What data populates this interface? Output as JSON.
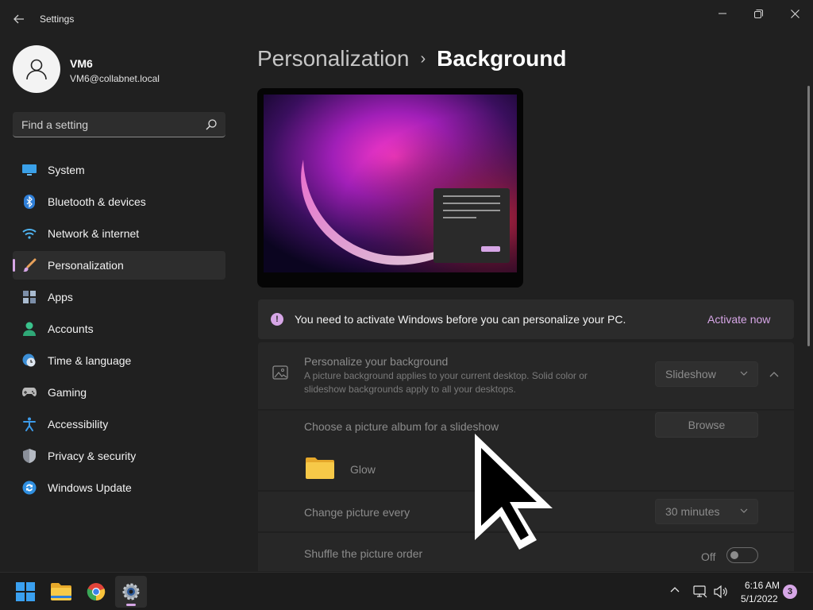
{
  "window": {
    "title": "Settings",
    "back_icon": "arrow-left-icon",
    "minimize_icon": "minimize-icon",
    "restore_icon": "restore-icon",
    "close_icon": "close-icon"
  },
  "profile": {
    "name": "VM6",
    "email": "VM6@collabnet.local",
    "avatar_icon": "person-icon"
  },
  "search": {
    "placeholder": "Find a setting",
    "icon": "search-icon"
  },
  "sidebar": {
    "items": [
      {
        "label": "System",
        "icon": "monitor-icon"
      },
      {
        "label": "Bluetooth & devices",
        "icon": "bluetooth-icon"
      },
      {
        "label": "Network & internet",
        "icon": "wifi-icon"
      },
      {
        "label": "Personalization",
        "icon": "brush-icon",
        "active": true
      },
      {
        "label": "Apps",
        "icon": "apps-icon"
      },
      {
        "label": "Accounts",
        "icon": "account-icon"
      },
      {
        "label": "Time & language",
        "icon": "globe-clock-icon"
      },
      {
        "label": "Gaming",
        "icon": "gamepad-icon"
      },
      {
        "label": "Accessibility",
        "icon": "accessibility-icon"
      },
      {
        "label": "Privacy & security",
        "icon": "shield-icon"
      },
      {
        "label": "Windows Update",
        "icon": "update-icon"
      }
    ]
  },
  "breadcrumb": {
    "parent": "Personalization",
    "separator": "›",
    "current": "Background"
  },
  "activation": {
    "message": "You need to activate Windows before you can personalize your PC.",
    "link": "Activate now"
  },
  "personalize_background": {
    "title": "Personalize your background",
    "description": "A picture background applies to your current desktop. Solid color or slideshow backgrounds apply to all your desktops.",
    "selected": "Slideshow"
  },
  "album": {
    "label": "Choose a picture album for a slideshow",
    "browse_label": "Browse",
    "folder_name": "Glow"
  },
  "interval": {
    "label": "Change picture every",
    "selected": "30 minutes"
  },
  "shuffle": {
    "label": "Shuffle the picture order",
    "state": "Off"
  },
  "taskbar": {
    "apps": [
      "start-icon",
      "file-explorer-icon",
      "chrome-icon",
      "settings-icon"
    ],
    "time": "6:16 AM",
    "date": "5/1/2022",
    "notification_count": "3"
  },
  "colors": {
    "accent": "#d6a6e6",
    "background": "#202020",
    "card": "#272727"
  }
}
